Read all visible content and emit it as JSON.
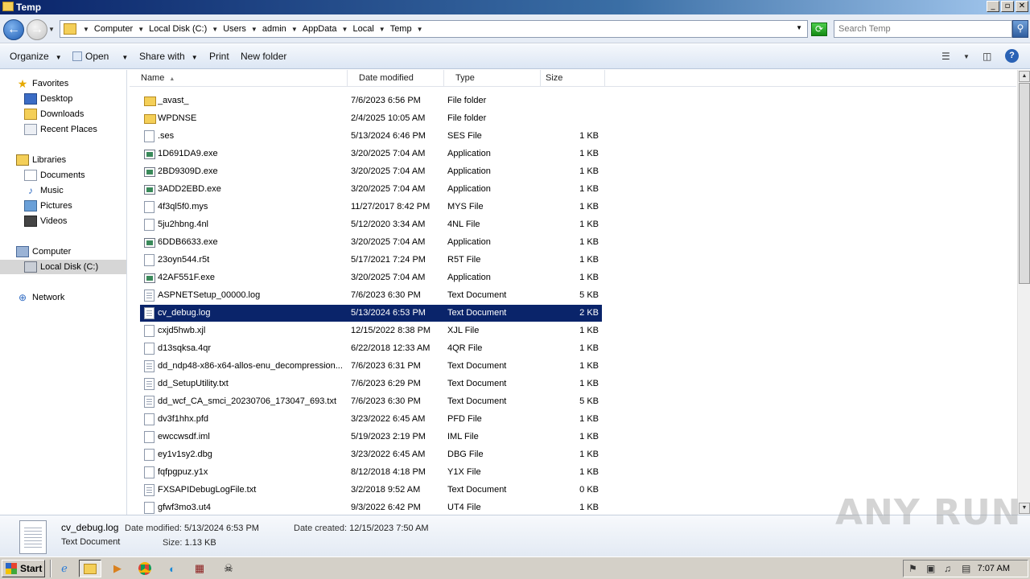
{
  "window": {
    "title": "Temp",
    "min": "0",
    "max": "1",
    "close": "r"
  },
  "address": {
    "crumbs": [
      "Computer",
      "Local Disk (C:)",
      "Users",
      "admin",
      "AppData",
      "Local",
      "Temp"
    ],
    "search_placeholder": "Search Temp"
  },
  "toolbar": {
    "organize": "Organize",
    "open": "Open",
    "share_with": "Share with",
    "print": "Print",
    "new_folder": "New folder"
  },
  "nav": {
    "favorites": "Favorites",
    "desktop": "Desktop",
    "downloads": "Downloads",
    "recent_places": "Recent Places",
    "libraries": "Libraries",
    "documents": "Documents",
    "music": "Music",
    "pictures": "Pictures",
    "videos": "Videos",
    "computer": "Computer",
    "local_disk": "Local Disk (C:)",
    "network": "Network"
  },
  "columns": {
    "name": "Name",
    "date": "Date modified",
    "type": "Type",
    "size": "Size"
  },
  "files": [
    {
      "name": "_avast_",
      "date": "7/6/2023 6:56 PM",
      "type": "File folder",
      "size": "",
      "icon": "folder"
    },
    {
      "name": "WPDNSE",
      "date": "2/4/2025 10:05 AM",
      "type": "File folder",
      "size": "",
      "icon": "folder"
    },
    {
      "name": ".ses",
      "date": "5/13/2024 6:46 PM",
      "type": "SES File",
      "size": "1 KB",
      "icon": "file"
    },
    {
      "name": "1D691DA9.exe",
      "date": "3/20/2025 7:04 AM",
      "type": "Application",
      "size": "1 KB",
      "icon": "exe"
    },
    {
      "name": "2BD9309D.exe",
      "date": "3/20/2025 7:04 AM",
      "type": "Application",
      "size": "1 KB",
      "icon": "exe"
    },
    {
      "name": "3ADD2EBD.exe",
      "date": "3/20/2025 7:04 AM",
      "type": "Application",
      "size": "1 KB",
      "icon": "exe"
    },
    {
      "name": "4f3ql5f0.mys",
      "date": "11/27/2017 8:42 PM",
      "type": "MYS File",
      "size": "1 KB",
      "icon": "file"
    },
    {
      "name": "5ju2hbng.4nl",
      "date": "5/12/2020 3:34 AM",
      "type": "4NL File",
      "size": "1 KB",
      "icon": "file"
    },
    {
      "name": "6DDB6633.exe",
      "date": "3/20/2025 7:04 AM",
      "type": "Application",
      "size": "1 KB",
      "icon": "exe"
    },
    {
      "name": "23oyn544.r5t",
      "date": "5/17/2021 7:24 PM",
      "type": "R5T File",
      "size": "1 KB",
      "icon": "file"
    },
    {
      "name": "42AF551F.exe",
      "date": "3/20/2025 7:04 AM",
      "type": "Application",
      "size": "1 KB",
      "icon": "exe"
    },
    {
      "name": "ASPNETSetup_00000.log",
      "date": "7/6/2023 6:30 PM",
      "type": "Text Document",
      "size": "5 KB",
      "icon": "text"
    },
    {
      "name": "cv_debug.log",
      "date": "5/13/2024 6:53 PM",
      "type": "Text Document",
      "size": "2 KB",
      "icon": "text",
      "selected": true
    },
    {
      "name": "cxjd5hwb.xjl",
      "date": "12/15/2022 8:38 PM",
      "type": "XJL File",
      "size": "1 KB",
      "icon": "file"
    },
    {
      "name": "d13sqksa.4qr",
      "date": "6/22/2018 12:33 AM",
      "type": "4QR File",
      "size": "1 KB",
      "icon": "file"
    },
    {
      "name": "dd_ndp48-x86-x64-allos-enu_decompression...",
      "date": "7/6/2023 6:31 PM",
      "type": "Text Document",
      "size": "1 KB",
      "icon": "text"
    },
    {
      "name": "dd_SetupUtility.txt",
      "date": "7/6/2023 6:29 PM",
      "type": "Text Document",
      "size": "1 KB",
      "icon": "text"
    },
    {
      "name": "dd_wcf_CA_smci_20230706_173047_693.txt",
      "date": "7/6/2023 6:30 PM",
      "type": "Text Document",
      "size": "5 KB",
      "icon": "text"
    },
    {
      "name": "dv3f1hhx.pfd",
      "date": "3/23/2022 6:45 AM",
      "type": "PFD File",
      "size": "1 KB",
      "icon": "file"
    },
    {
      "name": "ewccwsdf.iml",
      "date": "5/19/2023 2:19 PM",
      "type": "IML File",
      "size": "1 KB",
      "icon": "file"
    },
    {
      "name": "ey1v1sy2.dbg",
      "date": "3/23/2022 6:45 AM",
      "type": "DBG File",
      "size": "1 KB",
      "icon": "file"
    },
    {
      "name": "fqfpgpuz.y1x",
      "date": "8/12/2018 4:18 PM",
      "type": "Y1X File",
      "size": "1 KB",
      "icon": "file"
    },
    {
      "name": "FXSAPIDebugLogFile.txt",
      "date": "3/2/2018 9:52 AM",
      "type": "Text Document",
      "size": "0 KB",
      "icon": "text"
    },
    {
      "name": "gfwf3mo3.ut4",
      "date": "9/3/2022 6:42 PM",
      "type": "UT4 File",
      "size": "1 KB",
      "icon": "file"
    }
  ],
  "details": {
    "filename": "cv_debug.log",
    "type": "Text Document",
    "modified_label": "Date modified:",
    "modified": "5/13/2024 6:53 PM",
    "created_label": "Date created:",
    "created": "12/15/2023 7:50 AM",
    "size_label": "Size:",
    "size": "1.13 KB"
  },
  "watermark": "ANY RUN",
  "taskbar": {
    "start": "Start",
    "time": "7:07 AM"
  }
}
